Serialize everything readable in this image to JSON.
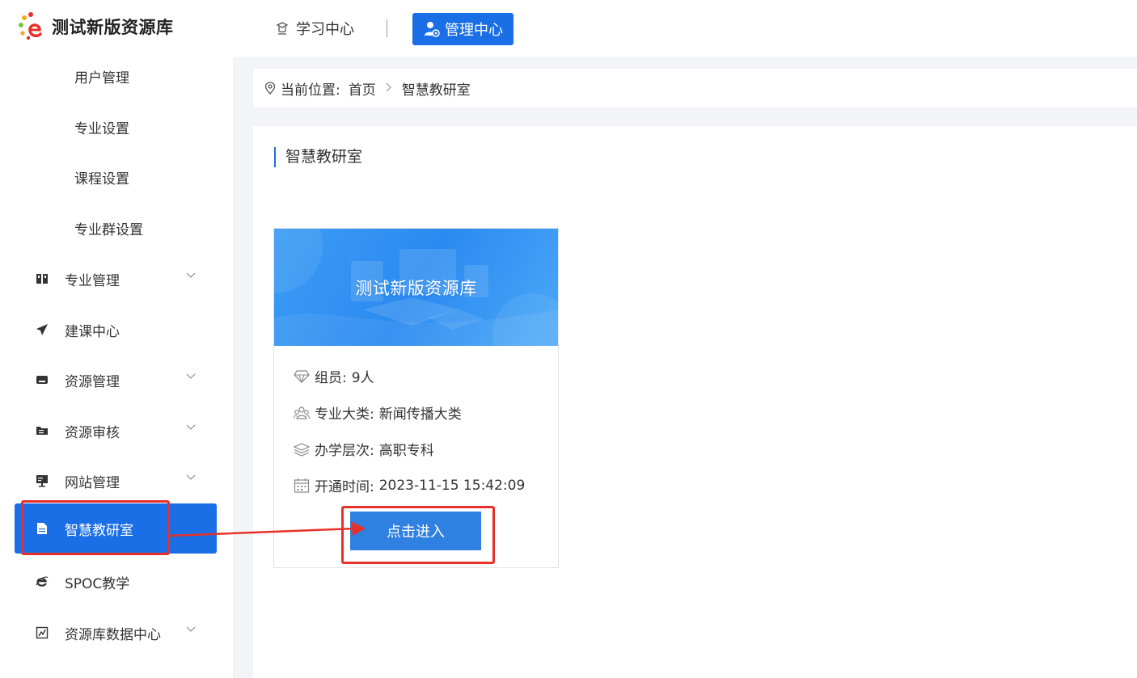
{
  "header": {
    "logo_text": "测试新版资源库",
    "nav_learn": "学习中心",
    "nav_admin": "管理中心"
  },
  "sidebar": {
    "sub_items": [
      "用户管理",
      "专业设置",
      "课程设置",
      "专业群设置"
    ],
    "items": [
      {
        "label": "专业管理",
        "icon": "book-icon",
        "has_chevron": true
      },
      {
        "label": "建课中心",
        "icon": "paper-plane-icon",
        "has_chevron": false
      },
      {
        "label": "资源管理",
        "icon": "inbox-icon",
        "has_chevron": true
      },
      {
        "label": "资源审核",
        "icon": "folder-list-icon",
        "has_chevron": true
      },
      {
        "label": "网站管理",
        "icon": "monitor-icon",
        "has_chevron": true
      },
      {
        "label": "智慧教研室",
        "icon": "document-icon",
        "has_chevron": false,
        "active": true
      },
      {
        "label": "SPOC教学",
        "icon": "ie-icon",
        "has_chevron": false
      },
      {
        "label": "资源库数据中心",
        "icon": "dashboard-icon",
        "has_chevron": true
      }
    ]
  },
  "breadcrumb": {
    "prefix": "当前位置:",
    "home": "首页",
    "current": "智慧教研室"
  },
  "panel": {
    "title": "智慧教研室"
  },
  "card": {
    "banner_title": "测试新版资源库",
    "members_label": "组员:",
    "members_value": "9人",
    "category_label": "专业大类:",
    "category_value": "新闻传播大类",
    "level_label": "办学层次:",
    "level_value": "高职专科",
    "open_time_label": "开通时间:",
    "open_time_value": "2023-11-15 15:42:09",
    "enter_button": "点击进入"
  },
  "colors": {
    "accent": "#1a6ee6",
    "highlight": "#e8302a",
    "button": "#2f80e0"
  }
}
